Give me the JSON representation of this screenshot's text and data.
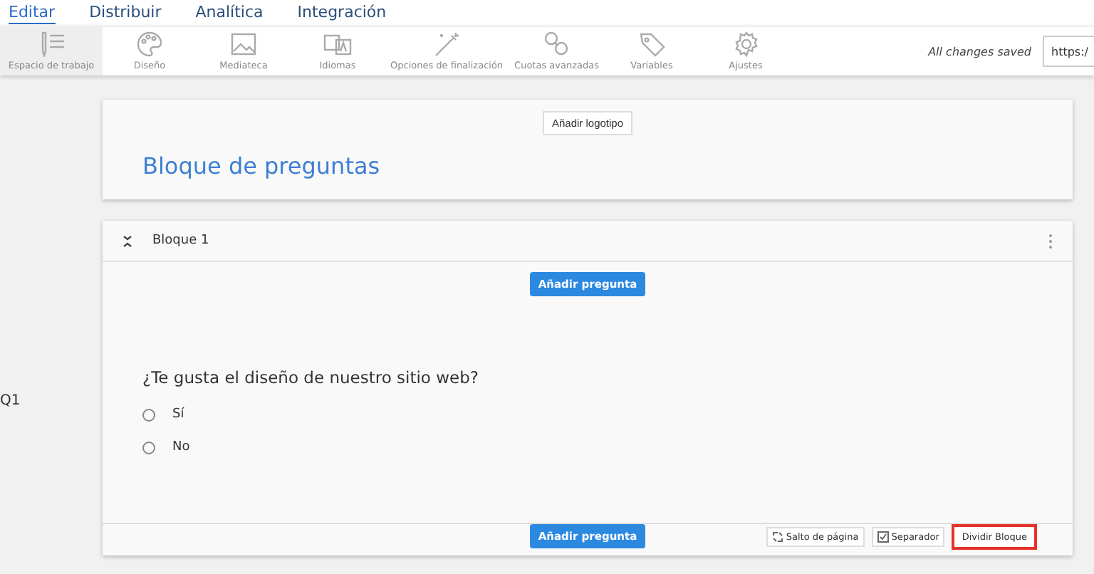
{
  "menu": [
    {
      "label": "Editar",
      "selected": true
    },
    {
      "label": "Distribuir",
      "selected": false
    },
    {
      "label": "Analítica",
      "selected": false
    },
    {
      "label": "Integración",
      "selected": false
    }
  ],
  "toolbar": {
    "items": [
      {
        "label": "Espacio de trabajo",
        "selected": true
      },
      {
        "label": "Diseño",
        "selected": false
      },
      {
        "label": "Mediateca",
        "selected": false
      },
      {
        "label": "Idiomas",
        "selected": false
      },
      {
        "label": "Opciones de finalización",
        "selected": false
      },
      {
        "label": "Cuotas avanzadas",
        "selected": false
      },
      {
        "label": "Variables",
        "selected": false
      },
      {
        "label": "Ajustes",
        "selected": false
      }
    ],
    "status": "All changes saved",
    "url": "https:/"
  },
  "side_label": "Q1",
  "header": {
    "logo_button": "Añadir logotipo",
    "title": "Bloque de preguntas"
  },
  "block": {
    "title": "Bloque 1",
    "add_top": "Añadir pregunta",
    "question": "¿Te gusta el diseño de nuestro sitio web?",
    "options": [
      {
        "label": "Sí",
        "selected": false
      },
      {
        "label": "No",
        "selected": false
      }
    ],
    "add_bottom": "Añadir pregunta",
    "actions": [
      {
        "label": "Salto de página",
        "highlighted": false
      },
      {
        "label": "Separador",
        "highlighted": false
      },
      {
        "label": "Dividir Bloque",
        "highlighted": true
      }
    ]
  }
}
